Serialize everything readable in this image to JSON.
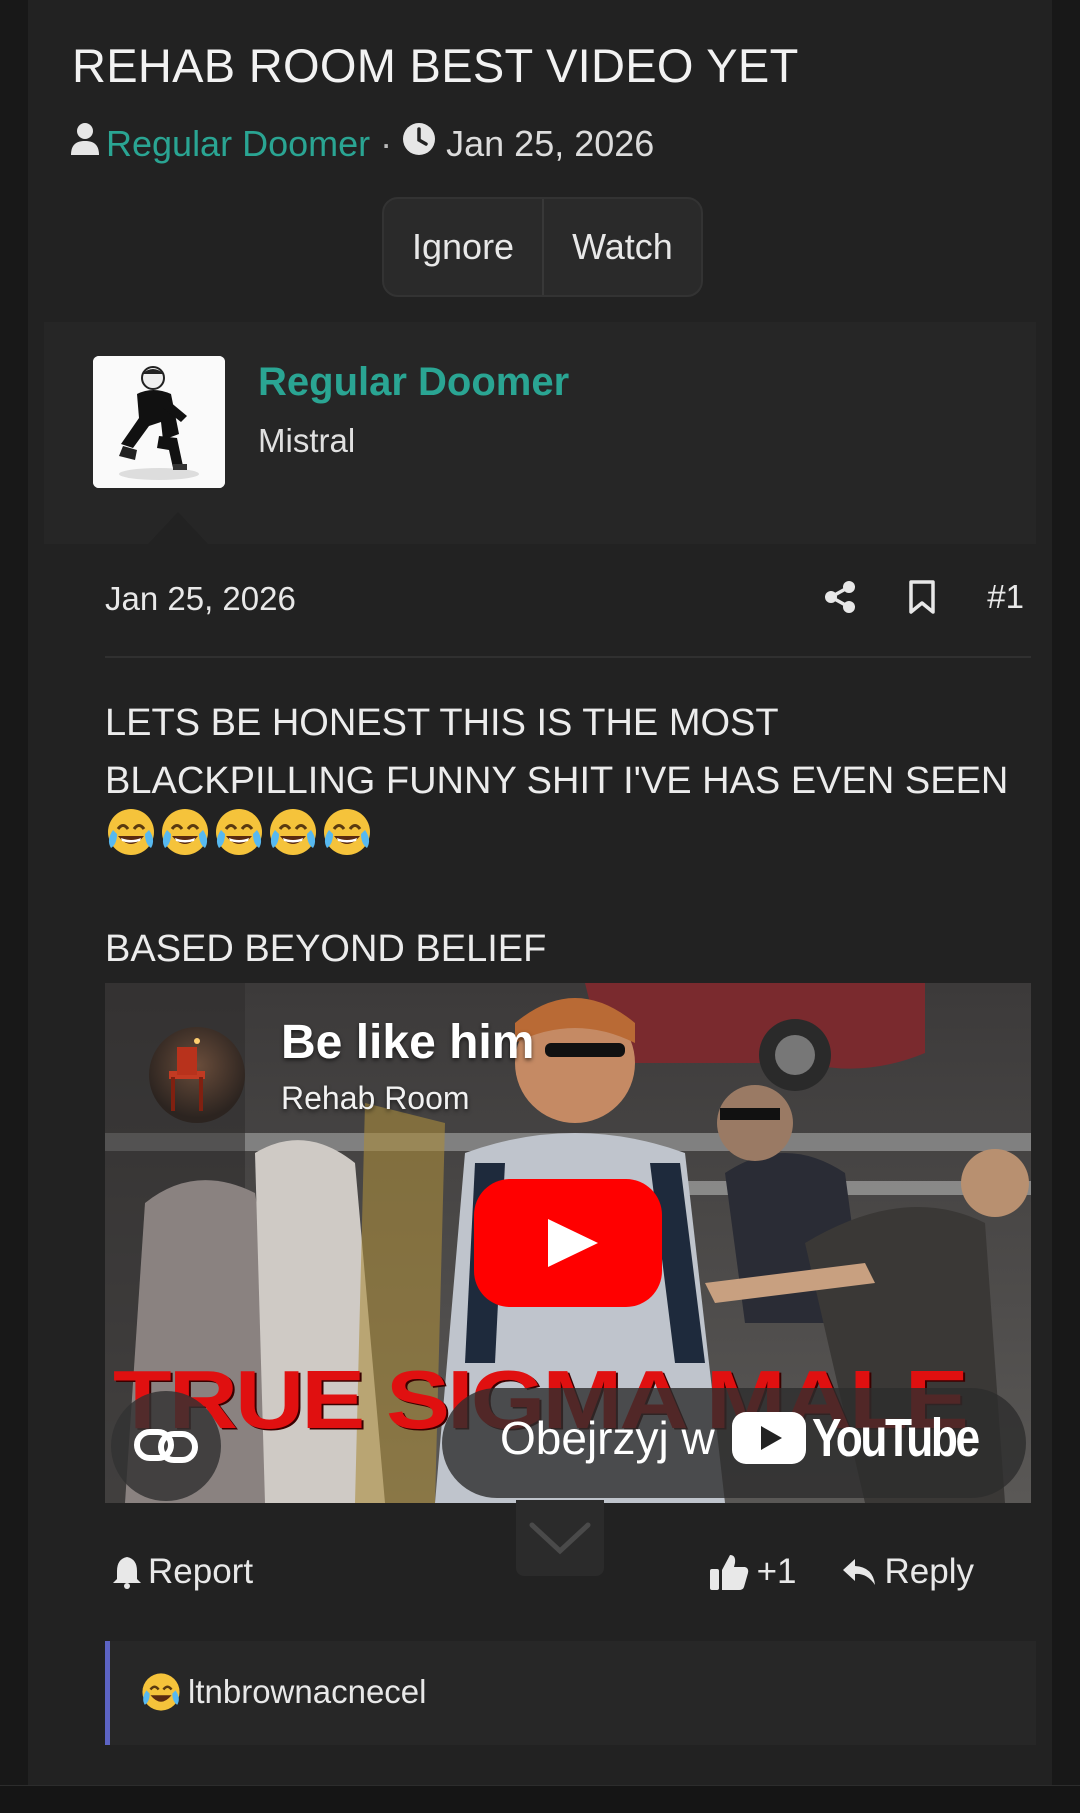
{
  "thread": {
    "title": "REHAB ROOM BEST VIDEO YET",
    "author": "Regular Doomer",
    "separator": "·",
    "date": "Jan 25, 2026"
  },
  "thread_buttons": {
    "ignore_label": "Ignore",
    "watch_label": "Watch"
  },
  "post": {
    "author_name": "Regular Doomer",
    "author_title": "Mistral",
    "date": "Jan 25, 2026",
    "number": "#1",
    "text_line": "LETS BE HONEST THIS IS THE MOST BLACKPILLING FUNNY SHIT I'VE HAS EVEN SEEN",
    "emoji_count": 5,
    "emoji_name": "joy-emoji",
    "text_2": "BASED BEYOND BELIEF"
  },
  "video": {
    "title": "Be like him",
    "channel": "Rehab Room",
    "overlay_text": "TRUE SIGMA MALE",
    "watch_on_label": "Obejrzyj w",
    "youtube_label": "YouTube",
    "play_color": "#ff0000"
  },
  "footer": {
    "report_label": "Report",
    "reaction_count": "+1",
    "reply_label": "Reply"
  },
  "reactions": {
    "users": "ltnbrownacnecel"
  },
  "colors": {
    "accent": "#2aa593",
    "reaction_bar": "#5d64c4",
    "background": "#222222"
  }
}
